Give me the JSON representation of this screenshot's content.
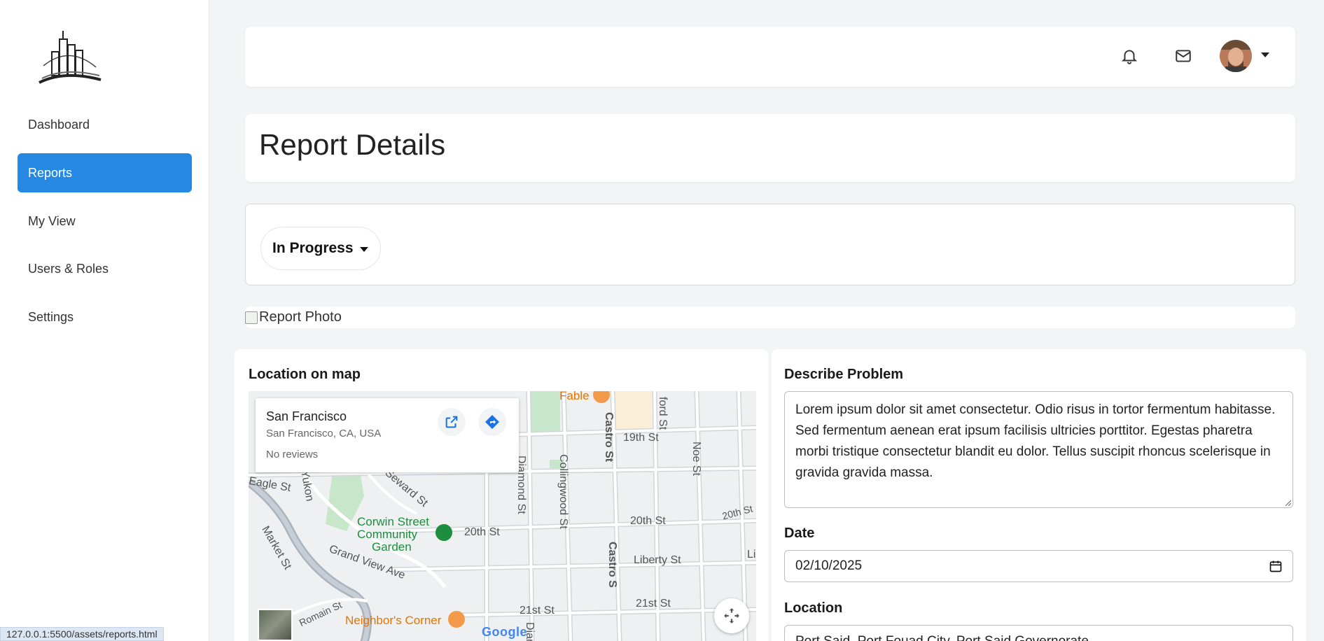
{
  "sidebar": {
    "logo_icon": "city-skyline-logo",
    "items": [
      {
        "label": "Dashboard",
        "active": false
      },
      {
        "label": "Reports",
        "active": true
      },
      {
        "label": "My View",
        "active": false
      },
      {
        "label": "Users & Roles",
        "active": false
      },
      {
        "label": "Settings",
        "active": false
      }
    ]
  },
  "topbar": {
    "icons": [
      "bell-icon",
      "mail-icon"
    ],
    "avatar_icon": "user-avatar"
  },
  "page": {
    "title": "Report Details"
  },
  "status": {
    "selected": "In Progress"
  },
  "photo": {
    "alt": "Report Photo"
  },
  "map": {
    "heading": "Location on map",
    "place_name": "San Francisco",
    "place_address": "San Francisco, CA, USA",
    "reviews": "No reviews",
    "labels": {
      "fable": "Fable",
      "nineteenth": "19th St",
      "castro": "Castro St",
      "collingwood": "Collingwood St",
      "diamond": "Diamond St",
      "noe": "Noe St",
      "eagle": "Eagle St",
      "yukon": "Yukon",
      "seward": "Seward St",
      "corwin1": "Corwin Street",
      "corwin2": "Community",
      "corwin3": "Garden",
      "twentieth1": "20th St",
      "twentieth2": "20th St",
      "twentieth3": "20th St",
      "market": "Market St",
      "grandview": "Grand View Ave",
      "liberty": "Liberty St",
      "castro2": "Castro S",
      "li": "Li",
      "romain": "Romain St",
      "neighbors": "Neighbor's Corner",
      "twentyfirst1": "21st St",
      "twentyfirst2": "21st St",
      "google": "Google",
      "ford": "ford St",
      "dia": "Diar"
    },
    "colors": {
      "park": "#c8e6c9",
      "road": "#ffffff",
      "bg": "#eef0f2",
      "freeway": "#aab4bf"
    }
  },
  "form": {
    "problem_label": "Describe Problem",
    "problem_text": "Lorem ipsum dolor sit amet consectetur. Odio risus in tortor fermentum habitasse. Sed fermentum aenean erat ipsum facilisis ultricies porttitor. Egestas pharetra morbi tristique consectetur blandit eu dolor. Tellus suscipit rhoncus scelerisque in gravida gravida massa.",
    "date_label": "Date",
    "date_value": "02/10/2025",
    "location_label": "Location",
    "location_value": "Port Said, Port Fouad City, Port Said Governorate"
  },
  "browser": {
    "status_url": "127.0.0.1:5500/assets/reports.html"
  },
  "colors": {
    "accent": "#2589e3",
    "page_bg": "#f3f4f6"
  }
}
